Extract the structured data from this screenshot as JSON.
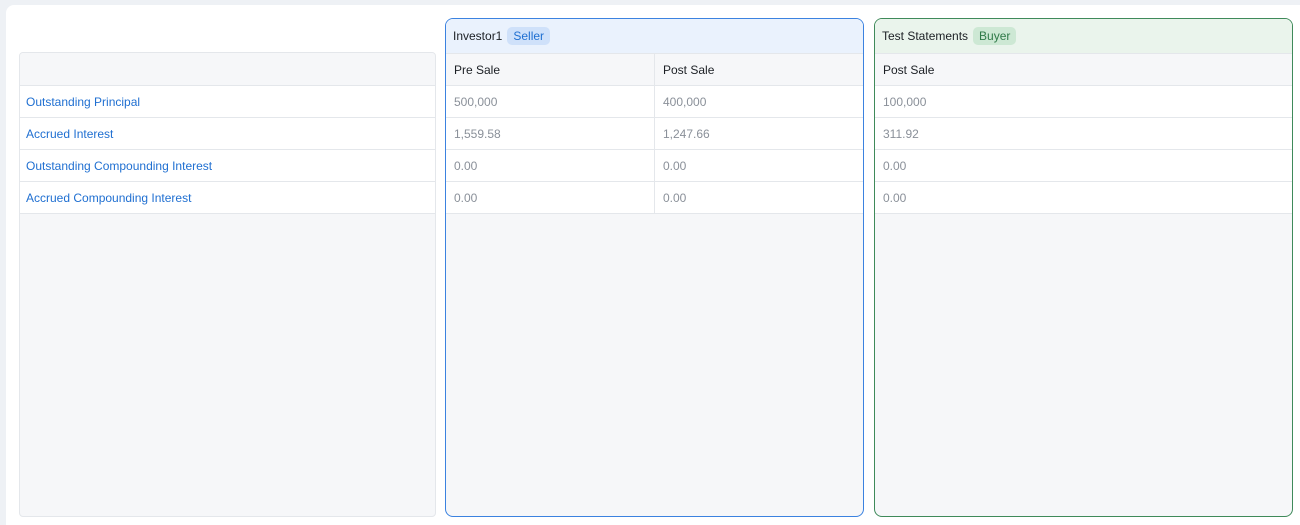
{
  "rows": [
    {
      "label": "Outstanding Principal"
    },
    {
      "label": "Accrued Interest"
    },
    {
      "label": "Outstanding Compounding Interest"
    },
    {
      "label": "Accrued Compounding Interest"
    }
  ],
  "seller": {
    "name": "Investor1",
    "role": "Seller",
    "columns": [
      "Pre Sale",
      "Post Sale"
    ],
    "values": [
      [
        "500,000",
        "400,000"
      ],
      [
        "1,559.58",
        "1,247.66"
      ],
      [
        "0.00",
        "0.00"
      ],
      [
        "0.00",
        "0.00"
      ]
    ]
  },
  "buyer": {
    "name": "Test Statements",
    "role": "Buyer",
    "columns": [
      "Post Sale"
    ],
    "values": [
      [
        "100,000"
      ],
      [
        "311.92"
      ],
      [
        "0.00"
      ],
      [
        "0.00"
      ]
    ]
  },
  "colors": {
    "seller_accent": "#3b82e0",
    "buyer_accent": "#3f8a5a",
    "link": "#1f6fd1"
  }
}
